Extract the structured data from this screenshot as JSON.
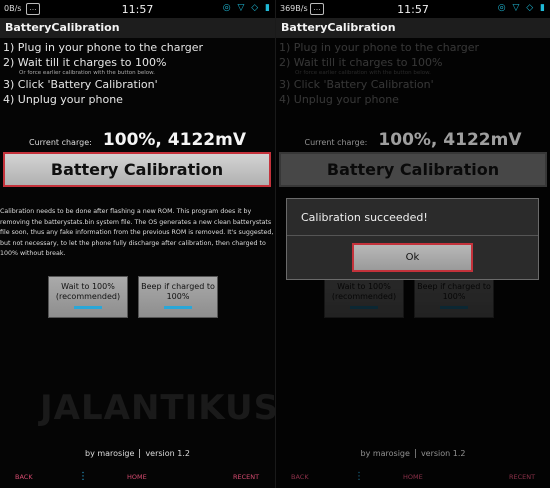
{
  "left": {
    "status": {
      "speed": "0B/s",
      "time": "11:57",
      "icons": "◎ ▽ ◇ ▮"
    },
    "title": "BatteryCalibration",
    "steps": [
      "1) Plug in your phone to the charger",
      "2) Wait till it charges to 100%",
      "3) Click 'Battery Calibration'",
      "4) Unplug your phone"
    ],
    "step_note": "Or force earlier calibration with the button below.",
    "charge_label": "Current charge:",
    "charge_value": "100%, 4122mV",
    "calibrate_button": "Battery Calibration",
    "info": "Calibration needs to be done after flashing a new ROM. This program does it by removing the batterystats.bin system file. The OS generates a new clean batterystats file soon, thus any fake information from the previous ROM is removed. It's suggested, but not necessary, to let the phone fully discharge after calibration, then charged to 100% without break.",
    "wait_button": "Wait to 100% (recommended)",
    "beep_button": "Beep if charged to 100%",
    "watermark": "JALANTIKUS",
    "footer": {
      "author": "by marosige",
      "version": "version 1.2"
    },
    "nav": {
      "back": "BACK",
      "menu": "⋮",
      "home": "HOME",
      "recent": "RECENT"
    }
  },
  "right": {
    "status": {
      "speed": "369B/s",
      "time": "11:57",
      "icons": "◎ ▽ ◇ ▮"
    },
    "title": "BatteryCalibration",
    "steps": [
      "1) Plug in your phone to the charger",
      "2) Wait till it charges to 100%",
      "3) Click 'Battery Calibration'",
      "4) Unplug your phone"
    ],
    "step_note": "Or force earlier calibration with the button below.",
    "charge_label": "Current charge:",
    "charge_value": "100%, 4122mV",
    "calibrate_button": "Battery Calibration",
    "wait_button": "Wait to 100% (recommended)",
    "beep_button": "Beep if charged to 100%",
    "footer": {
      "author": "by marosige",
      "version": "version 1.2"
    },
    "nav": {
      "back": "BACK",
      "menu": "⋮",
      "home": "HOME",
      "recent": "RECENT"
    },
    "dialog": {
      "message": "Calibration succeeded!",
      "ok": "Ok"
    }
  }
}
